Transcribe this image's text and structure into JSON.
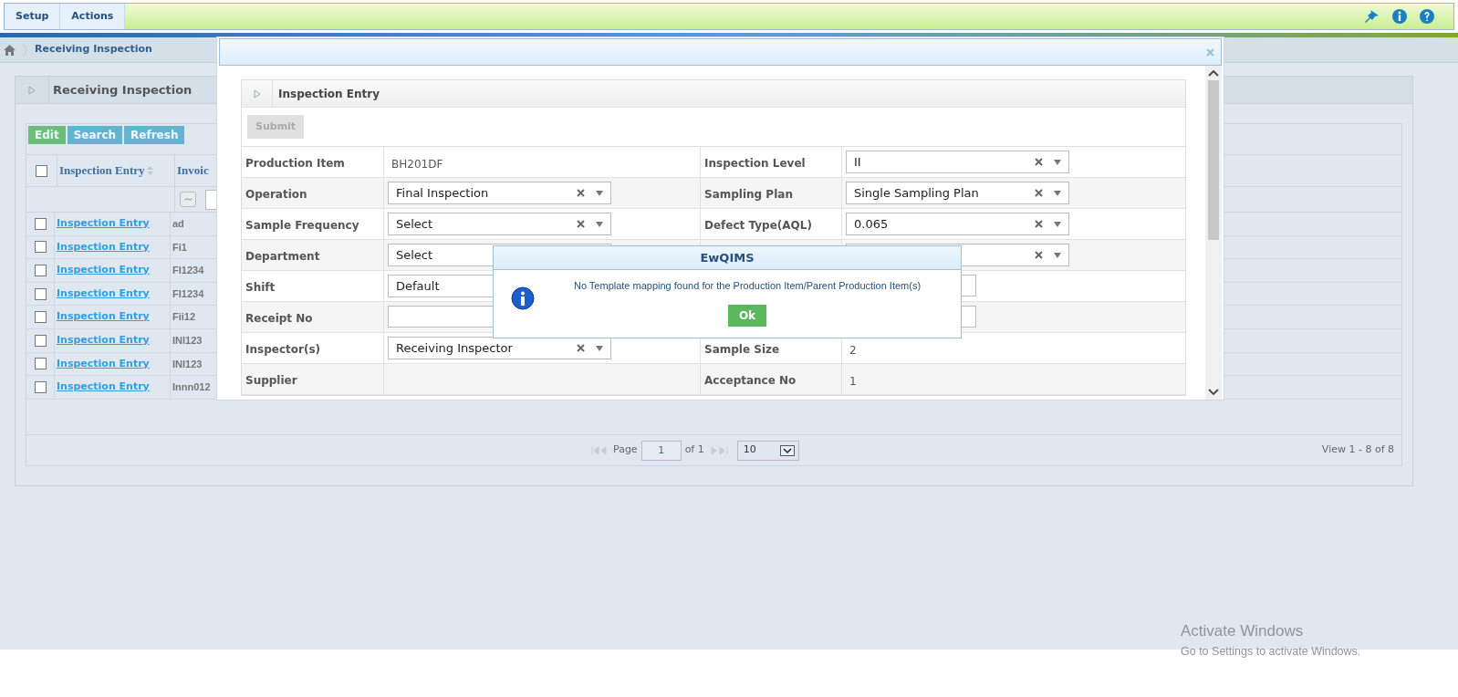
{
  "menu": [
    {
      "label": "Setup"
    },
    {
      "label": "Actions"
    }
  ],
  "breadcrumb": {
    "label": "Receiving Inspection"
  },
  "panel": {
    "title": "Receiving Inspection"
  },
  "toolbar": [
    {
      "label": "Edit",
      "kind": "success"
    },
    {
      "label": "Search",
      "kind": "info"
    },
    {
      "label": "Refresh",
      "kind": "info"
    }
  ],
  "grid": {
    "header_checked": false,
    "columns": [
      "Inspection Entry",
      "Invoic"
    ],
    "rows": [
      {
        "checked": false,
        "link": "Inspection Entry",
        "column_2": "ad"
      },
      {
        "checked": false,
        "link": "Inspection Entry",
        "column_2": "Fi1"
      },
      {
        "checked": false,
        "link": "Inspection Entry",
        "column_2": "FI1234"
      },
      {
        "checked": false,
        "link": "Inspection Entry",
        "column_2": "FI1234"
      },
      {
        "checked": false,
        "link": "Inspection Entry",
        "column_2": "Fii12"
      },
      {
        "checked": false,
        "link": "Inspection Entry",
        "column_2": "INI123"
      },
      {
        "checked": false,
        "link": "Inspection Entry",
        "column_2": "INI123"
      },
      {
        "checked": false,
        "link": "Inspection Entry",
        "column_2": "Innn012"
      }
    ]
  },
  "pager": {
    "page_label": "Page",
    "page": "1",
    "of": "of 1",
    "page_size": "10",
    "summary": "View 1 - 8 of 8"
  },
  "modal": {
    "section_title": "Inspection Entry",
    "submit": {
      "label": "Submit",
      "disabled": true
    },
    "rows": [
      {
        "left": {
          "label": "Production Item",
          "kind": "text",
          "value": "BH201DF"
        },
        "right": {
          "label": "Inspection Level",
          "kind": "select",
          "value": "II"
        }
      },
      {
        "left": {
          "label": "Operation",
          "kind": "select",
          "value": "Final Inspection"
        },
        "right": {
          "label": "Sampling Plan",
          "kind": "select",
          "value": "Single Sampling Plan"
        }
      },
      {
        "left": {
          "label": "Sample Frequency",
          "kind": "select",
          "value": "Select"
        },
        "right": {
          "label": "Defect Type(AQL)",
          "kind": "select",
          "value": "0.065"
        }
      },
      {
        "left": {
          "label": "Department",
          "kind": "select",
          "value": "Select"
        },
        "right": {
          "kind": "select"
        }
      },
      {
        "left": {
          "label": "Shift",
          "kind": "select",
          "value": "Default"
        },
        "right": {
          "kind": "input"
        }
      },
      {
        "left": {
          "label": "Receipt No",
          "kind": "input"
        },
        "right": {
          "kind": "input"
        }
      },
      {
        "left": {
          "label": "Inspector(s)",
          "kind": "select",
          "value": "Receiving Inspector"
        },
        "right": {
          "label": "Sample Size",
          "kind": "text",
          "value": "2"
        }
      },
      {
        "left": {
          "label": "Supplier",
          "kind": "empty"
        },
        "right": {
          "label": "Acceptance No",
          "kind": "text",
          "value": "1"
        }
      }
    ]
  },
  "alert": {
    "title": "EwQIMS",
    "message": "No Template mapping found for the Production Item/Parent Production Item(s)",
    "button": "Ok"
  },
  "os_notice": {
    "title": "Activate Windows",
    "subtitle": "Go to Settings to activate Windows."
  }
}
